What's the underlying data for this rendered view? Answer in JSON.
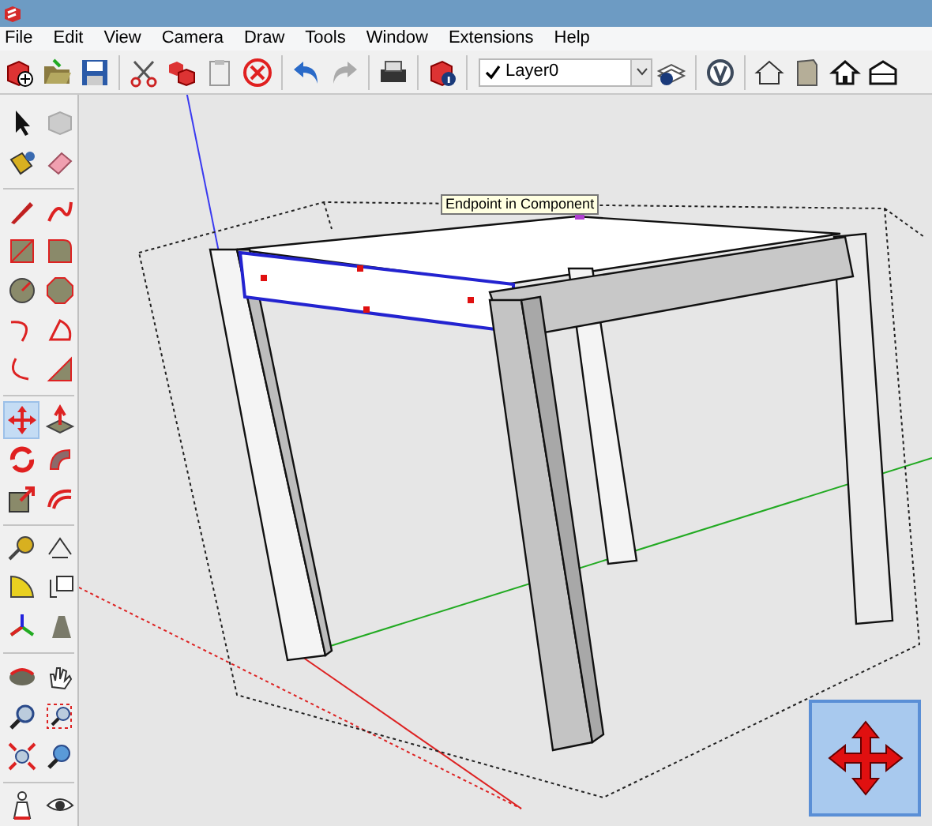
{
  "menu": [
    "File",
    "Edit",
    "View",
    "Camera",
    "Draw",
    "Tools",
    "Window",
    "Extensions",
    "Help"
  ],
  "layer_dropdown": {
    "value": "Layer0",
    "current": true
  },
  "tools": [
    {
      "selected": false
    },
    {
      "selected": false
    },
    {
      "selected": false
    },
    {
      "selected": false
    },
    {
      "selected": false
    },
    {
      "selected": false
    },
    {
      "selected": false
    },
    {
      "selected": false
    },
    {
      "selected": false
    },
    {
      "selected": false
    },
    {
      "selected": false
    },
    {
      "selected": false
    },
    {
      "selected": false
    },
    {
      "selected": false
    },
    {
      "selected": true
    },
    {
      "selected": false
    },
    {
      "selected": false
    },
    {
      "selected": false
    },
    {
      "selected": false
    },
    {
      "selected": false
    },
    {
      "selected": false
    },
    {
      "selected": false
    },
    {
      "selected": false
    },
    {
      "selected": false
    },
    {
      "selected": false
    },
    {
      "selected": false
    },
    {
      "selected": false
    },
    {
      "selected": false
    },
    {
      "selected": false
    },
    {
      "selected": false
    },
    {
      "selected": false
    },
    {
      "selected": false
    },
    {
      "selected": false
    },
    {
      "selected": false
    }
  ],
  "tooltip": "Endpoint in Component"
}
